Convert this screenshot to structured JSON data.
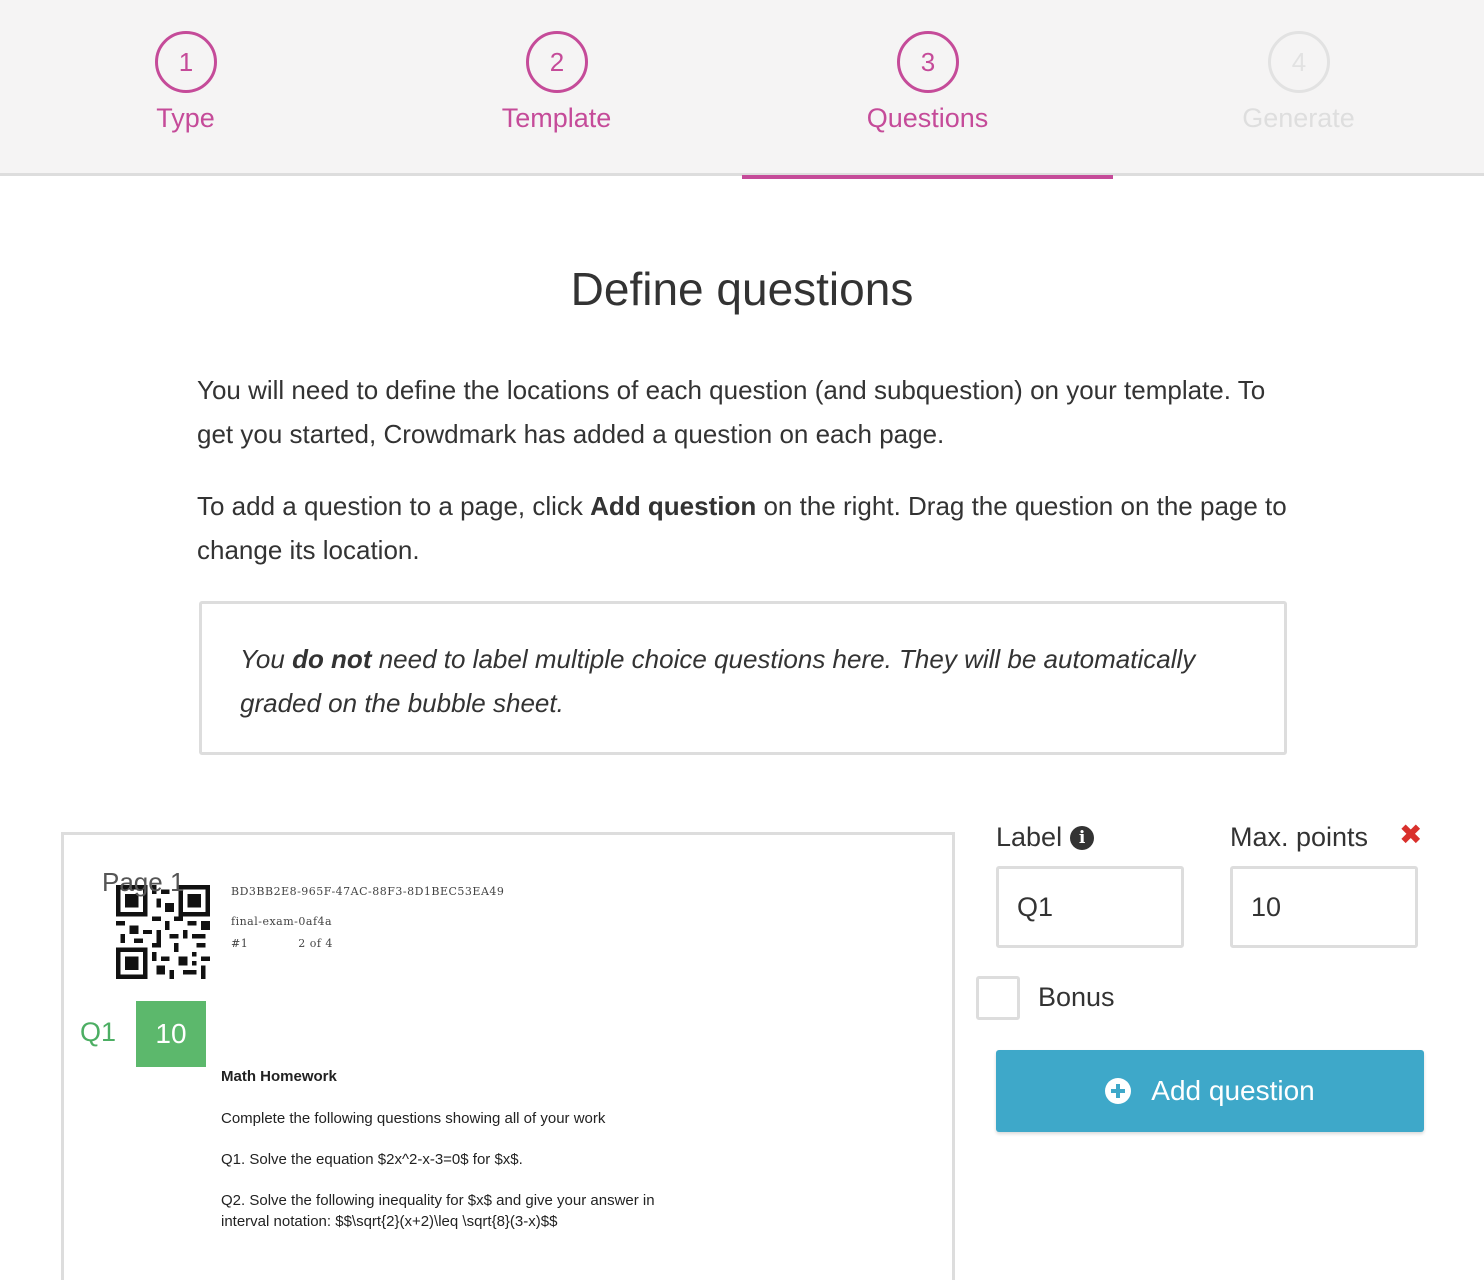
{
  "stepper": {
    "steps": [
      {
        "number": "1",
        "label": "Type"
      },
      {
        "number": "2",
        "label": "Template"
      },
      {
        "number": "3",
        "label": "Questions"
      },
      {
        "number": "4",
        "label": "Generate"
      }
    ]
  },
  "main": {
    "title": "Define questions",
    "intro_1": "You will need to define the locations of each question (and subquestion) on your template. To get you started, Crowdmark has added a question on each page.",
    "intro_2_prefix": "To add a question to a page, click ",
    "intro_2_bold": "Add question",
    "intro_2_suffix": " on the right. Drag the question on the page to change its location.",
    "note_prefix": "You ",
    "note_bold": "do not",
    "note_suffix": " need to label multiple choice questions here. They will be automatically graded on the bubble sheet."
  },
  "preview": {
    "page_label": "Page 1",
    "code_id": "BD3BB2E8-965F-47AC-88F3-8D1BEC53EA49",
    "exam_name": "final-exam-0af4a",
    "copy_number": "#1",
    "page_of": "2 of 4",
    "question_tag": {
      "label": "Q1",
      "points": "10"
    },
    "doc_title": "Math Homework",
    "doc_lines": [
      "Complete the following questions showing all of your work",
      "Q1. Solve the equation $2x^2-x-3=0$ for $x$.",
      "Q2. Solve the following inequality for $x$ and give your answer in interval notation: $$\\sqrt{2}(x+2)\\leq \\sqrt{8}(3-x)$$"
    ]
  },
  "editor": {
    "label_heading": "Label",
    "points_heading": "Max. points",
    "label_value": "Q1",
    "points_value": "10",
    "bonus_label": "Bonus",
    "add_button_label": "Add question"
  },
  "colors": {
    "accent": "#c54b99",
    "success": "#5cb86c",
    "primary_button": "#3ea8c9",
    "danger": "#d9302c"
  }
}
